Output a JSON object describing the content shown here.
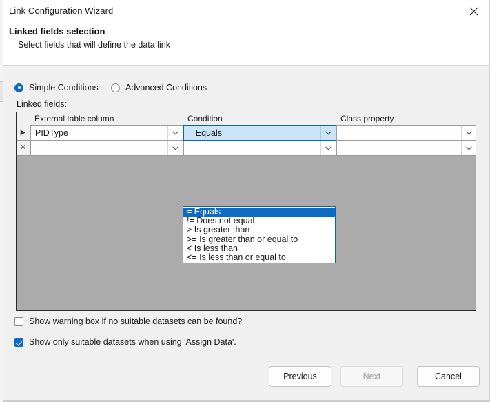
{
  "window": {
    "title": "Link Configuration Wizard",
    "close_icon": "close-icon"
  },
  "header": {
    "page_title": "Linked fields selection",
    "page_subtitle": "Select fields that will define the data link"
  },
  "conditions_mode": {
    "simple_label": "Simple  Conditions",
    "advanced_label": "Advanced Conditions",
    "selected": "Simple  Conditions"
  },
  "grid": {
    "label": "Linked fields:",
    "columns": [
      "External table column",
      "Condition",
      "Class property"
    ],
    "rows": [
      {
        "indicator": "▶",
        "external_table_column": "PIDType",
        "condition": "= Equals",
        "class_property": ""
      },
      {
        "indicator": "✳",
        "external_table_column": "",
        "condition": "",
        "class_property": ""
      }
    ]
  },
  "condition_dropdown": {
    "open": true,
    "selected": "= Equals",
    "options": [
      "= Equals",
      "!= Does not equal",
      "> Is greater than",
      ">= Is greater than or equal to",
      "< Is less than",
      "<= Is less than or equal to"
    ]
  },
  "options": {
    "show_warning_box": {
      "label": "Show warning box if no suitable datasets can be found?",
      "checked": false
    },
    "show_only_suitable": {
      "label": "Show only suitable datasets when using 'Assign Data'.",
      "checked": true
    }
  },
  "footer": {
    "previous_label": "Previous",
    "next_label": "Next",
    "next_disabled": true,
    "cancel_label": "Cancel"
  },
  "colors": {
    "accent": "#0c6cc4",
    "grid_empty": "#ababab",
    "dialog_bg": "#f0f0f0",
    "header_bg": "#ffffff",
    "active_cell": "#cce4f7"
  }
}
